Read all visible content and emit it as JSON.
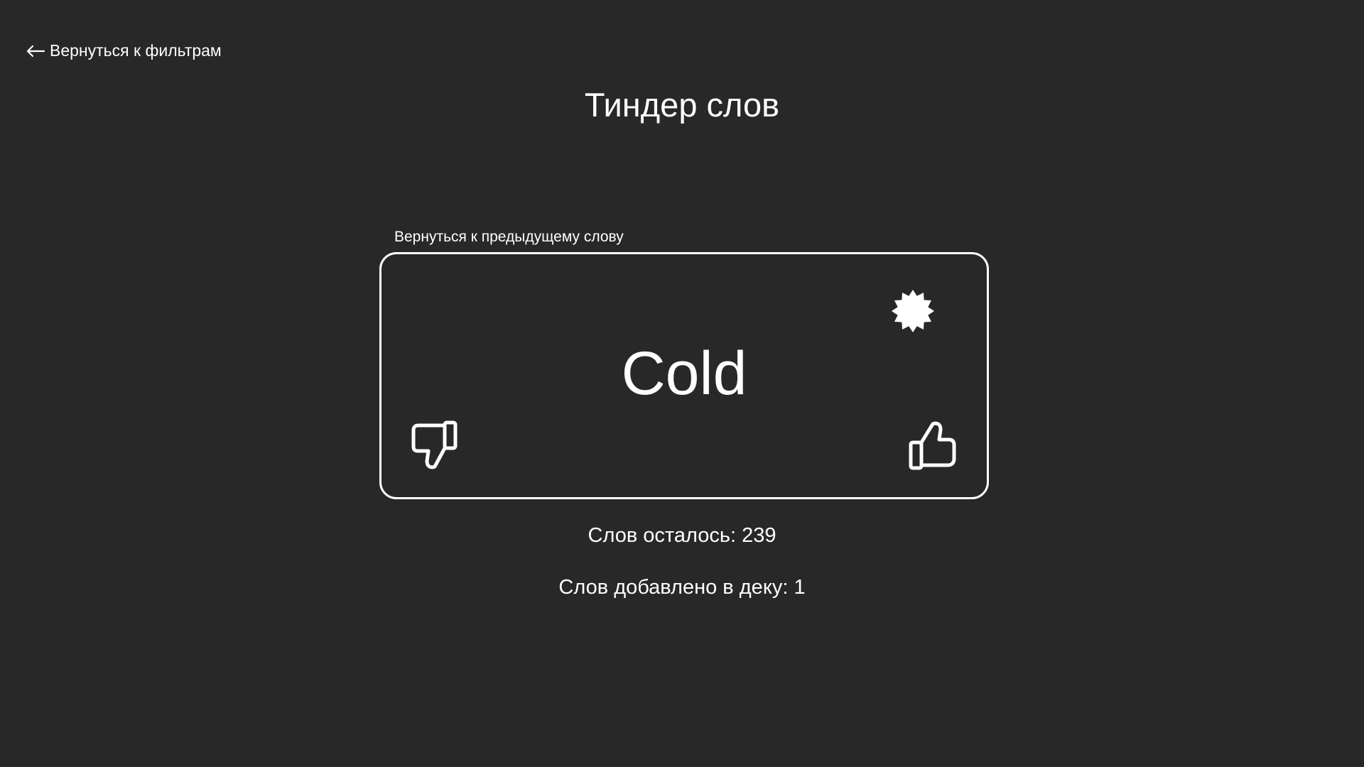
{
  "nav": {
    "back_label": "Вернуться к фильтрам",
    "back_icon": "arrow-left-icon"
  },
  "header": {
    "title": "Тиндер слов"
  },
  "card": {
    "prev_word_label": "Вернуться к предыдущему слову",
    "word": "Cold",
    "icons": {
      "badge": "badge-star-icon",
      "dislike": "thumbs-down-icon",
      "like": "thumbs-up-icon"
    },
    "border_color": "#ffffff"
  },
  "stats": {
    "remaining_label": "Слов осталось: 239",
    "added_label": "Слов добавлено в деку: 1"
  },
  "colors": {
    "background": "#282828",
    "foreground": "#ffffff"
  }
}
